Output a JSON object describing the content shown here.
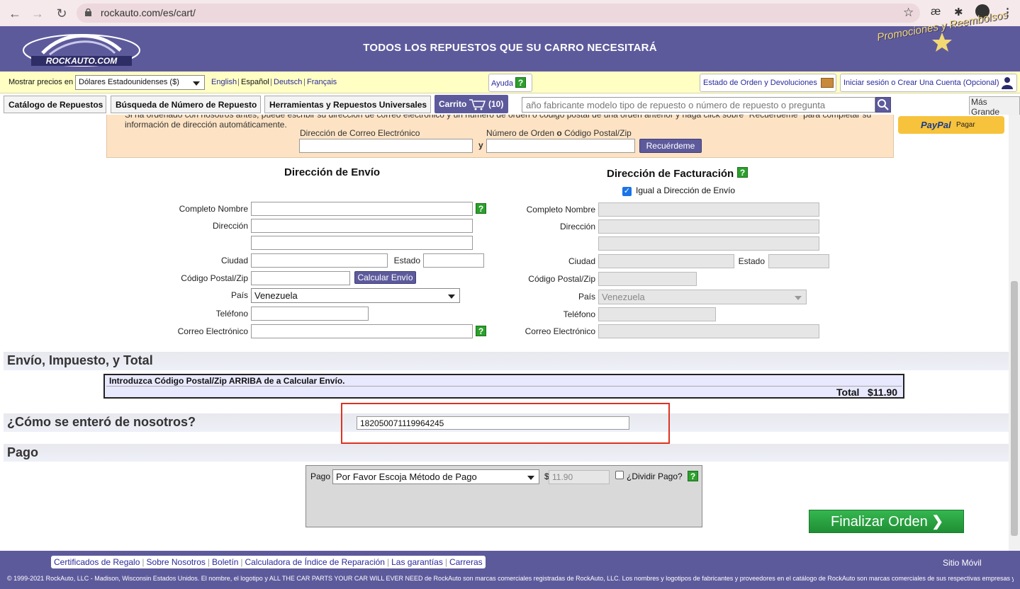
{
  "browser": {
    "url": "rockauto.com/es/cart/",
    "ext_label": "æ"
  },
  "header": {
    "slogan": "TODOS LOS REPUESTOS QUE SU CARRO NECESITARÁ",
    "promo": "Promociones y Reembolsos",
    "logo_text": "ROCKAUTO.COM"
  },
  "topbar": {
    "currency_label": "Mostrar precios en",
    "currency_value": "Dólares Estadounidenses ($)",
    "languages": [
      "English",
      "Español",
      "Deutsch",
      "Français"
    ],
    "help": "Ayuda",
    "order_status": "Estado de Orden y Devoluciones",
    "login": "Iniciar sesión o Crear Una Cuenta (Opcional)"
  },
  "tabs": {
    "catalog": "Catálogo de Repuestos",
    "part_search": "Búsqueda de Número de Repuesto",
    "tools": "Herramientas y Repuestos Universales",
    "cart": "Carrito",
    "cart_count": "(10)",
    "search_placeholder": "año fabricante modelo tipo de repuesto o número de repuesto o pregunta",
    "bigger": "Más Grande"
  },
  "recall": {
    "text": "Si ha ordenado con nosotros antes, puede escribir su dirección de correo electrónico y un número de orden o código postal de una orden anterior y haga click sobre \"Recuérdeme\" para completar su información de dirección automáticamente.",
    "email_label": "Dirección de Correo Electrónico",
    "order_label_a": "Número de Orden ",
    "order_label_o": "o",
    "order_label_b": " Código Postal/Zip",
    "and": "y",
    "button": "Recuérdeme"
  },
  "paypal": {
    "label": "PayPal",
    "action": "Pagar"
  },
  "shipping": {
    "title": "Dirección de Envío",
    "name": "Completo Nombre",
    "address": "Dirección",
    "city": "Ciudad",
    "state": "Estado",
    "zip": "Código Postal/Zip",
    "calc": "Calcular Envío",
    "country": "País",
    "country_value": "Venezuela",
    "phone": "Teléfono",
    "email": "Correo Electrónico"
  },
  "billing": {
    "title": "Dirección de Facturación",
    "same": "Igual a Dirección de Envío",
    "same_checked": true,
    "name": "Completo Nombre",
    "address": "Dirección",
    "city": "Ciudad",
    "state": "Estado",
    "zip": "Código Postal/Zip",
    "country": "País",
    "country_value": "Venezuela",
    "phone": "Teléfono",
    "email": "Correo Electrónico"
  },
  "totals": {
    "title": "Envío, Impuesto, y Total",
    "note": "Introduzca Código Postal/Zip ARRIBA de a Calcular Envío.",
    "total_label": "Total",
    "total_value": "$11.90"
  },
  "referral": {
    "title": "¿Cómo se enteró de nosotros?",
    "value": "182050071119964245"
  },
  "payment": {
    "title": "Pago",
    "label": "Pago",
    "method": "Por Favor Escoja Método de Pago",
    "currency": "$",
    "amount": "11.90",
    "split": "¿Dividir Pago?",
    "finalize": "Finalizar Orden"
  },
  "footer": {
    "links": [
      "Certificados de Regalo",
      "Sobre Nosotros",
      "Boletín",
      "Calculadora de Índice de Reparación",
      "Las garantías",
      "Carreras"
    ],
    "mobile": "Sitio Móvil",
    "copyright": "© 1999-2021 RockAuto, LLC - Madison, Wisconsin Estados Unidos. El nombre, el logotipo y ALL THE CAR PARTS YOUR CAR WILL EVER NEED de RockAuto son marcas comerciales registradas de RockAuto, LLC. Los nombres y logotipos de fabricantes y proveedores en el catálogo de RockAuto son marcas comerciales de sus respectivas empresas y se utilizan únicamente para identificar sus productos. Reservados todos los derechos."
  }
}
